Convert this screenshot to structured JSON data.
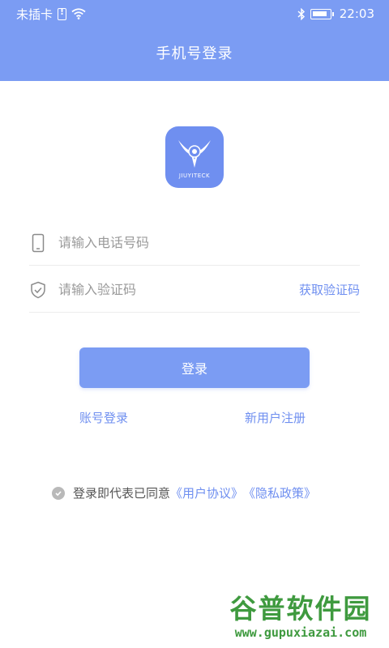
{
  "status_bar": {
    "carrier": "未插卡",
    "time": "22:03"
  },
  "header": {
    "title": "手机号登录"
  },
  "logo": {
    "text": "JIUYITECK",
    "color": "#6f8ff0"
  },
  "form": {
    "phone_placeholder": "请输入电话号码",
    "code_placeholder": "请输入验证码",
    "get_code_label": "获取验证码"
  },
  "actions": {
    "login_label": "登录",
    "account_login_label": "账号登录",
    "register_label": "新用户注册"
  },
  "agreement": {
    "prefix": "登录即代表已同意",
    "user_agreement": "《用户协议》",
    "privacy_policy": "《隐私政策》"
  },
  "watermark": {
    "title": "谷普软件园",
    "url": "www.gupuxiazai.com"
  },
  "colors": {
    "primary": "#7b9cf3",
    "link": "#6f8ff0",
    "watermark": "#3f9a3f"
  }
}
